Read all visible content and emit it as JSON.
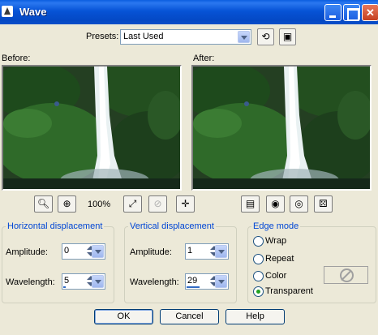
{
  "window": {
    "title": "Wave"
  },
  "presets": {
    "label": "Presets:",
    "value": "Last Used"
  },
  "preview": {
    "before_label": "Before:",
    "after_label": "After:",
    "zoom": "100%"
  },
  "horizontal": {
    "title": "Horizontal displacement",
    "amplitude_label": "Amplitude:",
    "amplitude": "0",
    "wavelength_label": "Wavelength:",
    "wavelength": "5"
  },
  "vertical": {
    "title": "Vertical displacement",
    "amplitude_label": "Amplitude:",
    "amplitude": "1",
    "wavelength_label": "Wavelength:",
    "wavelength": "29"
  },
  "edge": {
    "title": "Edge mode",
    "options": [
      "Wrap",
      "Repeat",
      "Color",
      "Transparent"
    ],
    "selected": "Transparent"
  },
  "buttons": {
    "ok": "OK",
    "cancel": "Cancel",
    "help": "Help"
  },
  "colors": {
    "titlebar": "#0653d6",
    "group_title": "#0046d5",
    "face": "#ece9d8"
  }
}
